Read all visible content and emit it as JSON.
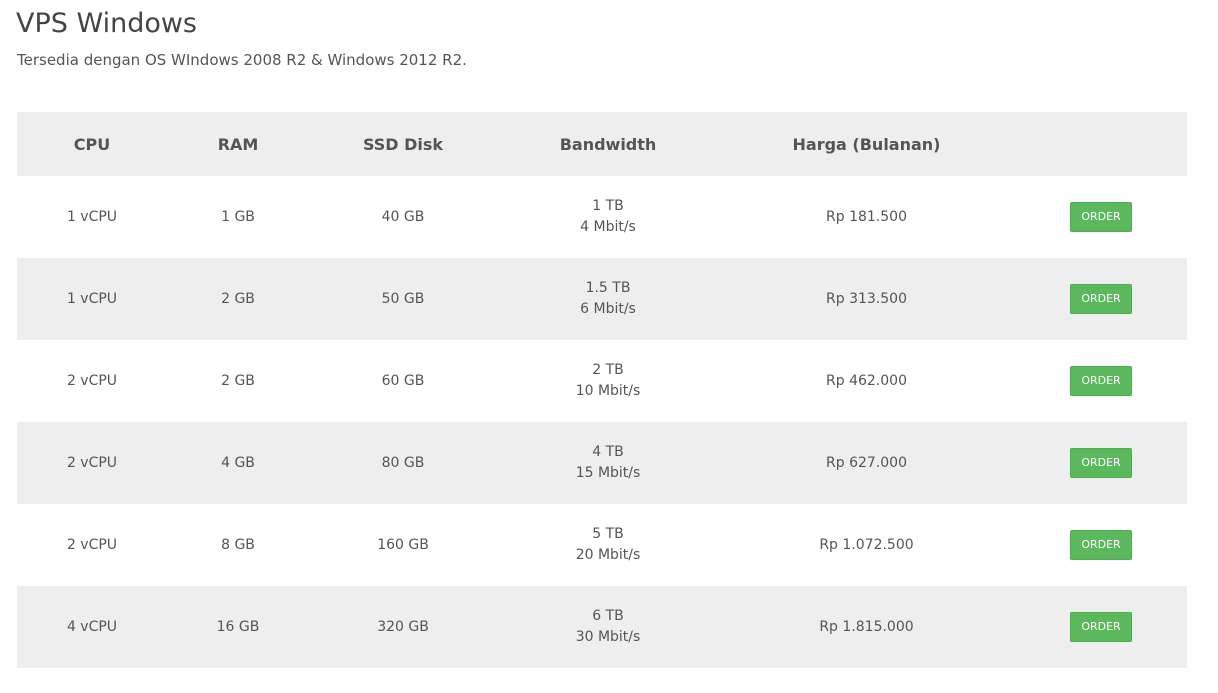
{
  "header": {
    "title": "VPS Windows",
    "subtitle": "Tersedia dengan OS WIndows 2008 R2 & Windows 2012 R2."
  },
  "table": {
    "columns": [
      "CPU",
      "RAM",
      "SSD Disk",
      "Bandwidth",
      "Harga (Bulanan)",
      ""
    ],
    "rows": [
      {
        "cpu": "1 vCPU",
        "ram": "1 GB",
        "ssd": "40 GB",
        "bandwidth": "1 TB",
        "speed": "4 Mbit/s",
        "price": "Rp 181.500",
        "action": "ORDER"
      },
      {
        "cpu": "1 vCPU",
        "ram": "2 GB",
        "ssd": "50 GB",
        "bandwidth": "1.5 TB",
        "speed": "6 Mbit/s",
        "price": "Rp 313.500",
        "action": "ORDER"
      },
      {
        "cpu": "2 vCPU",
        "ram": "2 GB",
        "ssd": "60 GB",
        "bandwidth": "2 TB",
        "speed": "10 Mbit/s",
        "price": "Rp 462.000",
        "action": "ORDER"
      },
      {
        "cpu": "2 vCPU",
        "ram": "4 GB",
        "ssd": "80 GB",
        "bandwidth": "4 TB",
        "speed": "15 Mbit/s",
        "price": "Rp 627.000",
        "action": "ORDER"
      },
      {
        "cpu": "2 vCPU",
        "ram": "8 GB",
        "ssd": "160 GB",
        "bandwidth": "5 TB",
        "speed": "20 Mbit/s",
        "price": "Rp 1.072.500",
        "action": "ORDER"
      },
      {
        "cpu": "4 vCPU",
        "ram": "16 GB",
        "ssd": "320 GB",
        "bandwidth": "6 TB",
        "speed": "30 Mbit/s",
        "price": "Rp 1.815.000",
        "action": "ORDER"
      }
    ]
  },
  "colors": {
    "order_button": "#5cb85c",
    "row_stripe": "#eeeeee",
    "text": "#555555"
  }
}
